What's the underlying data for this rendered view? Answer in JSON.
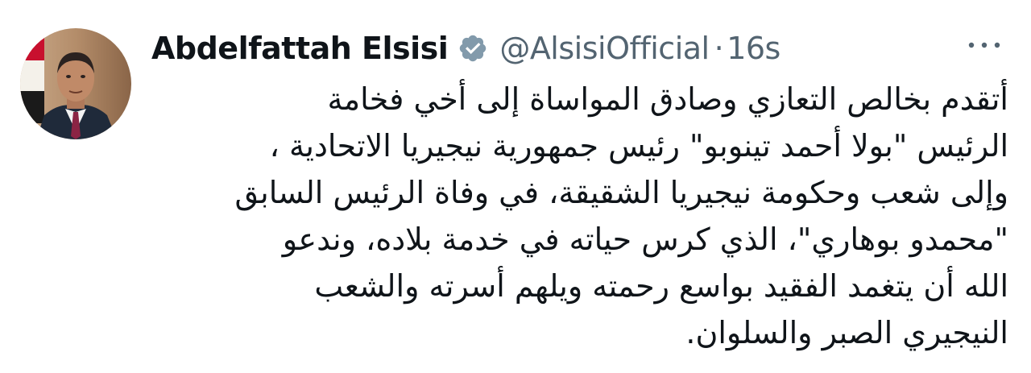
{
  "author": {
    "name": "Abdelfattah Elsisi",
    "handle": "@AlsisiOfficial",
    "separator": "·",
    "timestamp": "16s",
    "verified": true,
    "verified_color": "#829aab",
    "avatar_icon": "profile-photo"
  },
  "more_icon": "more-horizontal-icon",
  "tweet": {
    "lines": [
      "أتقدم بخالص التعازي وصادق المواساة إلى أخي فخامة",
      "الرئيس \"بولا أحمد تينوبو\" رئيس جمهورية نيجيريا الاتحادية ،",
      "وإلى شعب وحكومة نيجيريا الشقيقة، في وفاة الرئيس السابق",
      "\"محمدو بوهاري\"، الذي كرس حياته في خدمة بلاده، وندعو",
      "الله أن يتغمد الفقيد بواسع رحمته ويلهم أسرته والشعب",
      "النيجيري الصبر والسلوان."
    ]
  }
}
